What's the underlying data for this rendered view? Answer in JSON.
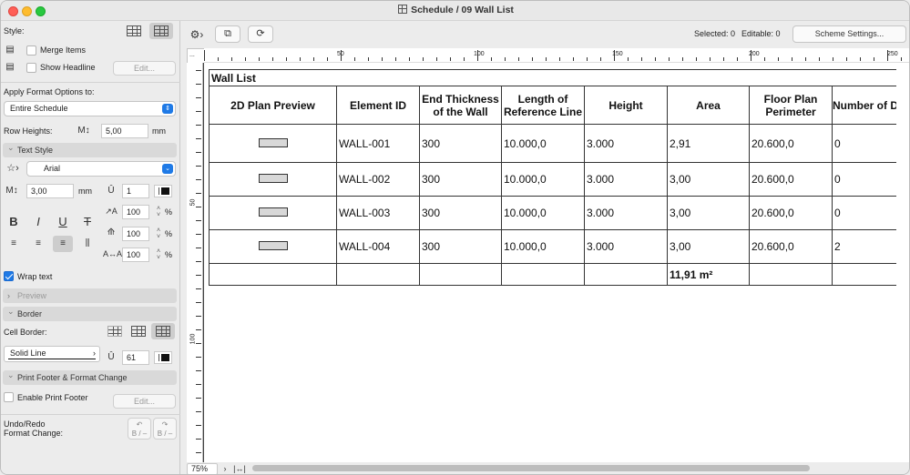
{
  "window": {
    "title": "Schedule / 09 Wall List"
  },
  "panel": {
    "style_label": "Style:",
    "merge_items": "Merge Items",
    "show_headline": "Show Headline",
    "edit_label": "Edit...",
    "apply_format_label": "Apply Format Options to:",
    "apply_format_value": "Entire Schedule",
    "row_heights_label": "Row Heights:",
    "row_heights_value": "5,00",
    "row_heights_unit": "mm",
    "text_style_section": "Text Style",
    "font_value": "Arial",
    "font_size_value": "3,00",
    "font_size_unit": "mm",
    "pen_value": "1",
    "scale_x": "100",
    "scale_y": "100",
    "spacing": "100",
    "percent": "%",
    "wrap_text": "Wrap text",
    "preview_section": "Preview",
    "border_section": "Border",
    "cell_border_label": "Cell Border:",
    "line_type": "Solid Line",
    "border_pen": "61",
    "print_footer_section": "Print Footer & Format Change",
    "enable_print_footer": "Enable Print Footer",
    "edit_label2": "Edit...",
    "undo_redo_label": "Undo/Redo\nFormat Change:",
    "undo_glyph": "B / –",
    "redo_glyph": "B / –"
  },
  "toolbar": {
    "selected_label": "Selected: 0",
    "editable_label": "Editable: 0",
    "scheme_button": "Scheme Settings..."
  },
  "ruler": {
    "top_ticks": [
      "...",
      "50",
      "100",
      "150",
      "200",
      "250"
    ],
    "left_ticks": [
      "50",
      "100"
    ]
  },
  "schedule": {
    "title": "Wall List",
    "headers": [
      "2D Plan Preview",
      "Element ID",
      "End Thickness of the Wall",
      "Length of Reference Line",
      "Height",
      "Area",
      "Floor Plan Perimeter",
      "Number of Doors"
    ],
    "rows": [
      {
        "id": "WALL-001",
        "thickness": "300",
        "length": "10.000,0",
        "height": "3.000",
        "area": "2,91",
        "perimeter": "20.600,0",
        "doors": "0"
      },
      {
        "id": "WALL-002",
        "thickness": "300",
        "length": "10.000,0",
        "height": "3.000",
        "area": "3,00",
        "perimeter": "20.600,0",
        "doors": "0"
      },
      {
        "id": "WALL-003",
        "thickness": "300",
        "length": "10.000,0",
        "height": "3.000",
        "area": "3,00",
        "perimeter": "20.600,0",
        "doors": "0"
      },
      {
        "id": "WALL-004",
        "thickness": "300",
        "length": "10.000,0",
        "height": "3.000",
        "area": "3,00",
        "perimeter": "20.600,0",
        "doors": "2"
      }
    ],
    "total_area": "11,91 m²"
  },
  "statusbar": {
    "zoom": "75%"
  }
}
